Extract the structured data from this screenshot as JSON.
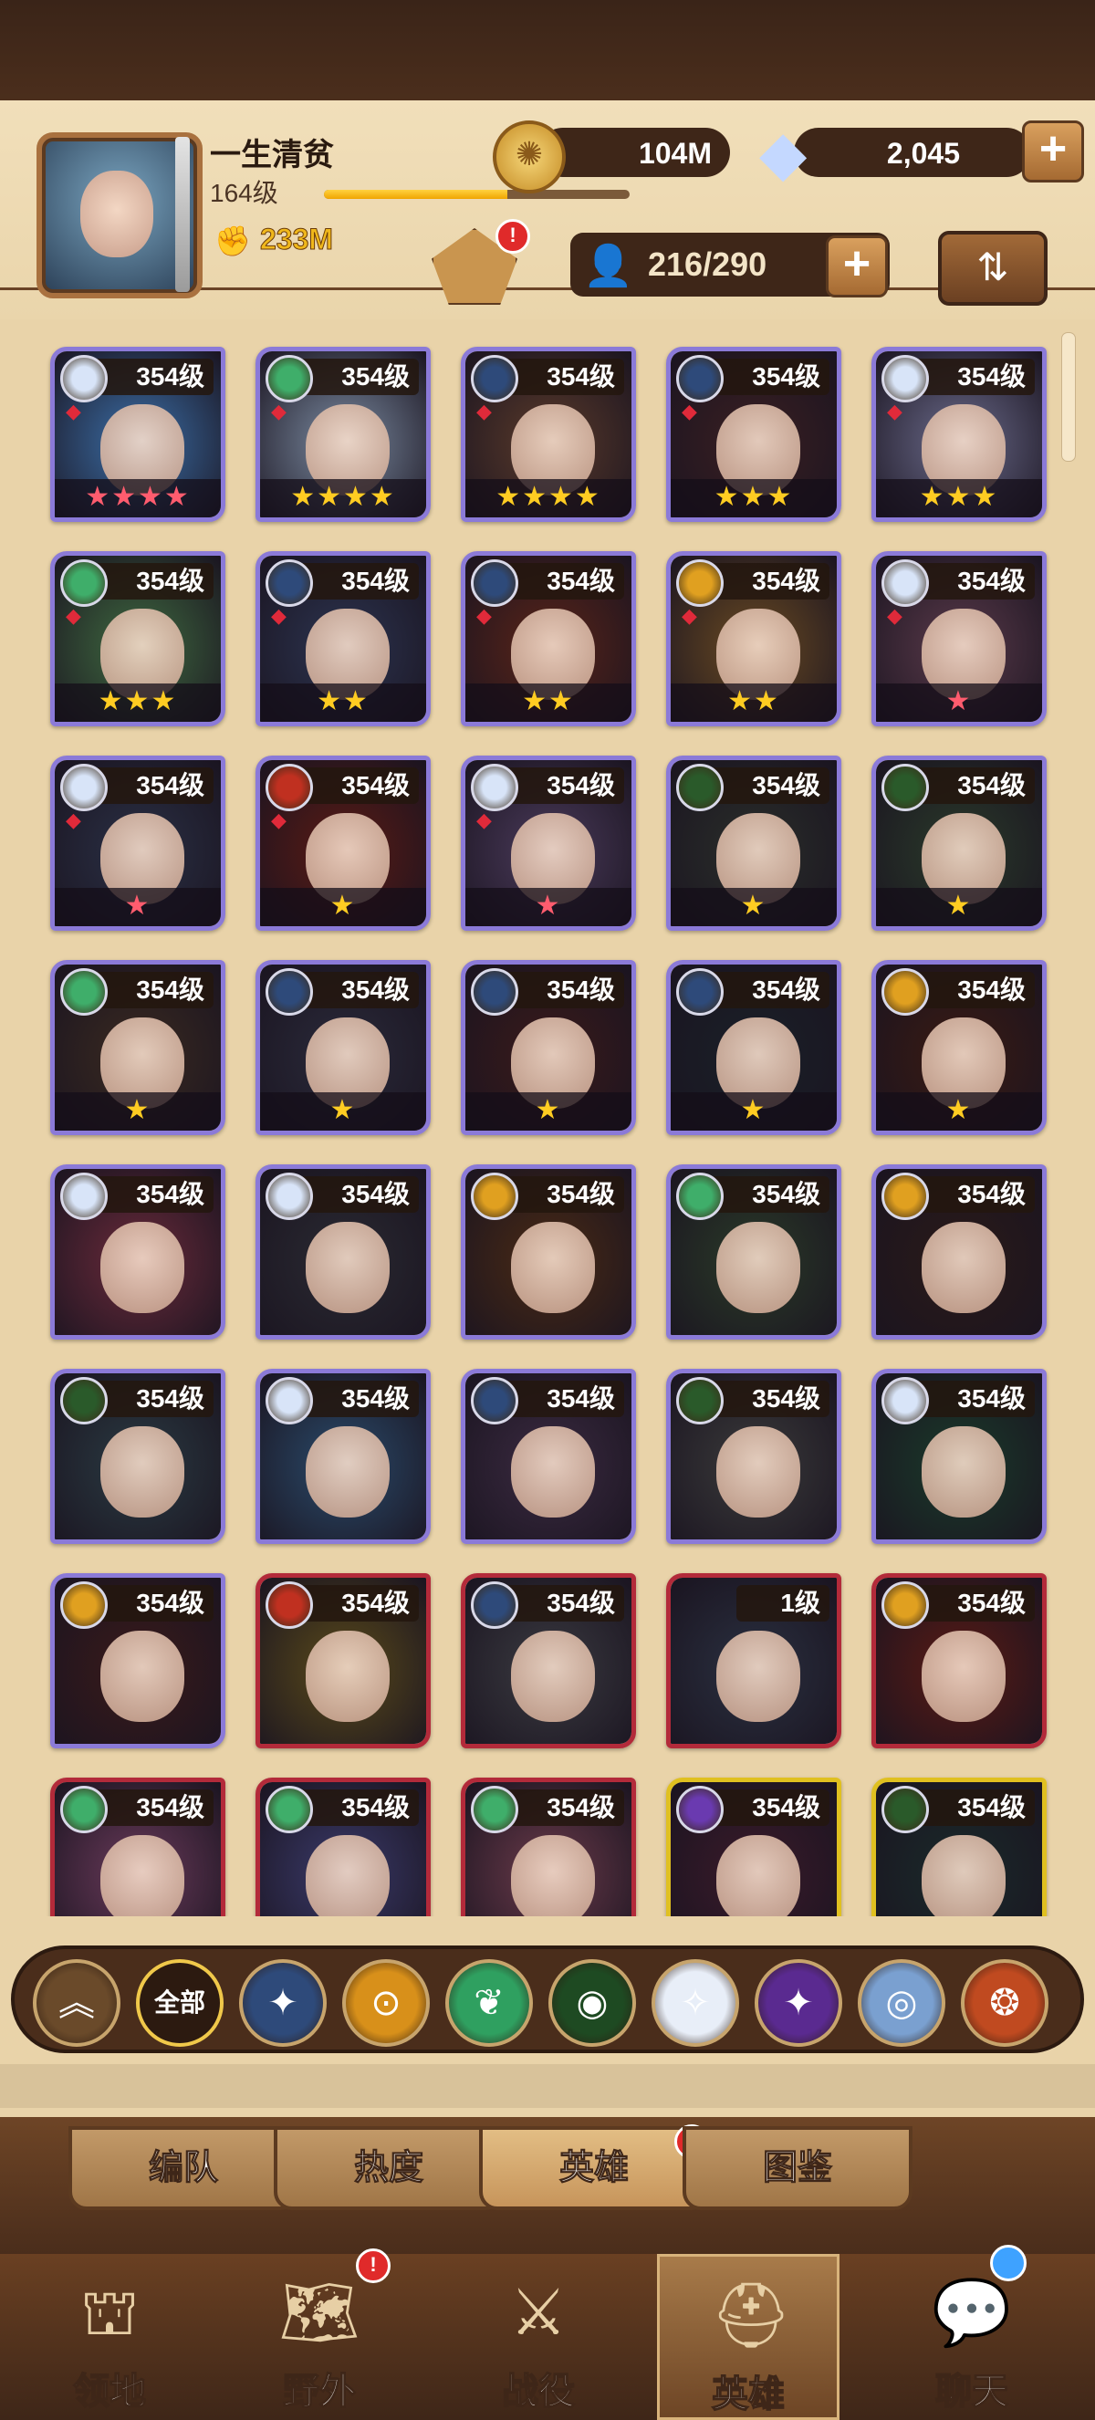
{
  "player": {
    "name": "一生清贫",
    "level": "164级",
    "exp_fraction": 0.6,
    "power": "233M"
  },
  "resources": {
    "gold": "104M",
    "diamonds": "2,045"
  },
  "camp": {
    "badge": "!"
  },
  "hero_capacity": "216/290",
  "heroes": [
    {
      "level": "354级",
      "stars": "★★★★",
      "star_color": "red",
      "frame": "purple",
      "faction": "celestial",
      "color": "#3b6fa8"
    },
    {
      "level": "354级",
      "stars": "★★★★",
      "star_color": "gold",
      "frame": "purple",
      "faction": "wilder",
      "color": "#7a8aa0"
    },
    {
      "level": "354级",
      "stars": "★★★★",
      "star_color": "gold",
      "frame": "purple",
      "faction": "lightbearer",
      "color": "#5a3a2a"
    },
    {
      "level": "354级",
      "stars": "★★★",
      "star_color": "gold",
      "frame": "purple",
      "faction": "lightbearer",
      "color": "#3a1f22"
    },
    {
      "level": "354级",
      "stars": "★★★",
      "star_color": "gold",
      "frame": "purple",
      "faction": "celestial",
      "color": "#6a6a8a"
    },
    {
      "level": "354级",
      "stars": "★★★",
      "star_color": "gold",
      "frame": "purple",
      "faction": "wilder",
      "color": "#3f6a40"
    },
    {
      "level": "354级",
      "stars": "★★",
      "star_color": "gold",
      "frame": "purple",
      "faction": "lightbearer",
      "color": "#2c3450"
    },
    {
      "level": "354级",
      "stars": "★★",
      "star_color": "gold",
      "frame": "purple",
      "faction": "lightbearer",
      "color": "#5a2418"
    },
    {
      "level": "354级",
      "stars": "★★",
      "star_color": "gold",
      "frame": "purple",
      "faction": "mauler",
      "color": "#6a4a22"
    },
    {
      "level": "354级",
      "stars": "★",
      "star_color": "red",
      "frame": "purple",
      "faction": "celestial",
      "color": "#5a3a4a"
    },
    {
      "level": "354级",
      "stars": "★",
      "star_color": "red",
      "frame": "purple",
      "faction": "celestial",
      "color": "#2a3045"
    },
    {
      "level": "354级",
      "stars": "★",
      "star_color": "gold",
      "frame": "purple",
      "faction": "hypogean",
      "color": "#5a1a14"
    },
    {
      "level": "354级",
      "stars": "★",
      "star_color": "red",
      "frame": "purple",
      "faction": "celestial",
      "color": "#4a3a5a"
    },
    {
      "level": "354级",
      "stars": "★",
      "star_color": "gold",
      "frame": "purple",
      "faction": "graveborn",
      "color": "#2a2e2a"
    },
    {
      "level": "354级",
      "stars": "★",
      "star_color": "gold",
      "frame": "purple",
      "faction": "graveborn",
      "color": "#2a3a2a"
    },
    {
      "level": "354级",
      "stars": "★",
      "star_color": "gold",
      "frame": "purple",
      "faction": "wilder",
      "color": "#3a2a20"
    },
    {
      "level": "354级",
      "stars": "★",
      "star_color": "gold",
      "frame": "purple",
      "faction": "lightbearer",
      "color": "#2a2a3a"
    },
    {
      "level": "354级",
      "stars": "★",
      "star_color": "gold",
      "frame": "purple",
      "faction": "lightbearer",
      "color": "#3a1a1a"
    },
    {
      "level": "354级",
      "stars": "★",
      "star_color": "gold",
      "frame": "purple",
      "faction": "lightbearer",
      "color": "#1a2028"
    },
    {
      "level": "354级",
      "stars": "★",
      "star_color": "gold",
      "frame": "purple",
      "faction": "mauler",
      "color": "#3a1a12"
    },
    {
      "level": "354级",
      "stars": "",
      "star_color": "gold",
      "frame": "purple",
      "faction": "celestial",
      "color": "#6a2a3a"
    },
    {
      "level": "354级",
      "stars": "",
      "star_color": "gold",
      "frame": "purple",
      "faction": "celestial",
      "color": "#2a2a32"
    },
    {
      "level": "354级",
      "stars": "",
      "star_color": "gold",
      "frame": "purple",
      "faction": "mauler",
      "color": "#4a2a14"
    },
    {
      "level": "354级",
      "stars": "",
      "star_color": "gold",
      "frame": "purple",
      "faction": "wilder",
      "color": "#2a3a28"
    },
    {
      "level": "354级",
      "stars": "",
      "star_color": "gold",
      "frame": "purple",
      "faction": "mauler",
      "color": "#2a1a18"
    },
    {
      "level": "354级",
      "stars": "",
      "star_color": "gold",
      "frame": "purple",
      "faction": "graveborn",
      "color": "#2a3a42"
    },
    {
      "level": "354级",
      "stars": "",
      "star_color": "gold",
      "frame": "purple",
      "faction": "celestial",
      "color": "#2a4a6a"
    },
    {
      "level": "354级",
      "stars": "",
      "star_color": "gold",
      "frame": "purple",
      "faction": "lightbearer",
      "color": "#3a2a40"
    },
    {
      "level": "354级",
      "stars": "",
      "star_color": "gold",
      "frame": "purple",
      "faction": "graveborn",
      "color": "#3a3a3a"
    },
    {
      "level": "354级",
      "stars": "",
      "star_color": "gold",
      "frame": "purple",
      "faction": "celestial",
      "color": "#1a3a2a"
    },
    {
      "level": "354级",
      "stars": "",
      "star_color": "gold",
      "frame": "purple",
      "faction": "mauler",
      "color": "#3a1a1a"
    },
    {
      "level": "354级",
      "stars": "",
      "star_color": "gold",
      "frame": "red",
      "faction": "hypogean",
      "color": "#5a4a1a"
    },
    {
      "level": "354级",
      "stars": "",
      "star_color": "gold",
      "frame": "red",
      "faction": "lightbearer",
      "color": "#3a3a40"
    },
    {
      "level": "1级",
      "stars": "",
      "star_color": "gold",
      "frame": "red",
      "faction": "",
      "color": "#2a3040"
    },
    {
      "level": "354级",
      "stars": "",
      "star_color": "gold",
      "frame": "red",
      "faction": "mauler",
      "color": "#5a1a14"
    },
    {
      "level": "354级",
      "stars": "",
      "star_color": "gold",
      "frame": "red",
      "faction": "wilder",
      "color": "#6a3a5a"
    },
    {
      "level": "354级",
      "stars": "",
      "star_color": "gold",
      "frame": "red",
      "faction": "wilder",
      "color": "#3a3a6a"
    },
    {
      "level": "354级",
      "stars": "",
      "star_color": "gold",
      "frame": "red",
      "faction": "wilder",
      "color": "#6a3a4a"
    },
    {
      "level": "354级",
      "stars": "",
      "star_color": "gold",
      "frame": "gold",
      "faction": "dimensional",
      "color": "#3a1a2a"
    },
    {
      "level": "354级",
      "stars": "",
      "star_color": "gold",
      "frame": "gold",
      "faction": "graveborn",
      "color": "#1a2a2a"
    }
  ],
  "faction_colors": {
    "celestial": "#d8e4f8",
    "lightbearer": "#2e4a7a",
    "mauler": "#e0a020",
    "wilder": "#3fae6a",
    "graveborn": "#2a5a2a",
    "hypogean": "#c03020",
    "dimensional": "#6a3ab0",
    "": "transparent"
  },
  "filters": [
    {
      "icon": "chevron-up-icon",
      "label": "︽",
      "bg": "#6a4a2a"
    },
    {
      "icon": "all-filter",
      "label": "全部",
      "bg": "#2c1a10"
    },
    {
      "icon": "lightbearer-icon",
      "label": "✦",
      "bg": "#2e4a7a"
    },
    {
      "icon": "mauler-icon",
      "label": "⊙",
      "bg": "#d8901a"
    },
    {
      "icon": "wilder-icon",
      "label": "❦",
      "bg": "#2fa060"
    },
    {
      "icon": "graveborn-icon",
      "label": "◉",
      "bg": "#1e4a22"
    },
    {
      "icon": "celestial-icon",
      "label": "✧",
      "bg": "#e8eef8"
    },
    {
      "icon": "hypogean-icon",
      "label": "✦",
      "bg": "#5a2a90"
    },
    {
      "icon": "dimensional-icon",
      "label": "◎",
      "bg": "#7aa0d0"
    },
    {
      "icon": "fire-icon",
      "label": "❂",
      "bg": "#c04a20"
    }
  ],
  "tabs": [
    {
      "label": "编队",
      "active": false
    },
    {
      "label": "热度",
      "active": false
    },
    {
      "label": "英雄",
      "active": true,
      "badge": "!"
    },
    {
      "label": "图鉴",
      "active": false
    }
  ],
  "nav": [
    {
      "label": "领地",
      "icon": "castle-icon",
      "glyph": "⛫",
      "active": false
    },
    {
      "label": "野外",
      "icon": "map-scroll-icon",
      "glyph": "🗺",
      "active": false,
      "badge": "!"
    },
    {
      "label": "战役",
      "icon": "sword-shield-icon",
      "glyph": "⚔",
      "active": false
    },
    {
      "label": "英雄",
      "icon": "helmet-icon",
      "glyph": "⛑",
      "active": true
    },
    {
      "label": "聊天",
      "icon": "chat-icon",
      "glyph": "💬",
      "active": false,
      "blue_dot": true
    }
  ]
}
